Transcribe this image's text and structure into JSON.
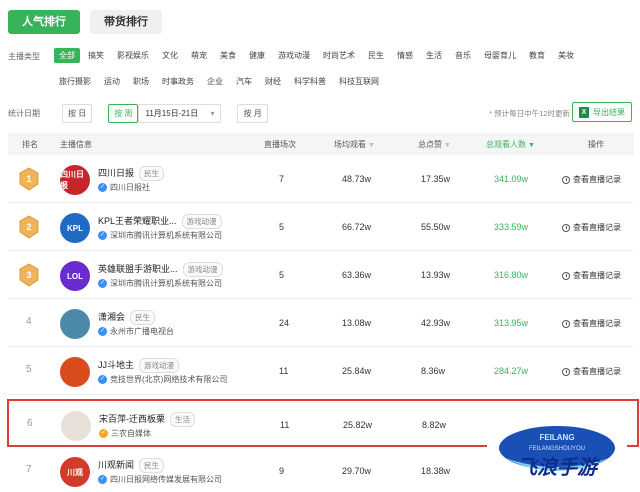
{
  "top_tabs": [
    "人气排行",
    "带货排行"
  ],
  "filter": {
    "label": "主播类型",
    "row1": [
      "全部",
      "搞笑",
      "影视娱乐",
      "文化",
      "萌宠",
      "美食",
      "健康",
      "游戏动漫",
      "时尚艺术",
      "民生",
      "情感",
      "生活",
      "音乐",
      "母婴育儿",
      "教育",
      "美妆"
    ],
    "row2": [
      "旅行摄影",
      "运动",
      "职场",
      "时事政务",
      "企业",
      "汽车",
      "财经",
      "科学科普",
      "科技互联网"
    ]
  },
  "date": {
    "label": "统计日期",
    "day": "按 日",
    "week": "按 周",
    "range": "11月15日-21日",
    "range_icon": "▾",
    "month": "按 月",
    "note": "* 预计每日中午12时更新",
    "export": "导出结果"
  },
  "headers": {
    "rank": "排名",
    "info": "主播信息",
    "sessions": "直播场次",
    "avg_views": "场均观看",
    "likes": "总点赞",
    "viewers": "总观看人数",
    "op": "操作"
  },
  "rows": [
    {
      "rank": "1",
      "name": "四川日报",
      "tag": "民生",
      "org": "四川日报社",
      "sessions": "7",
      "avg": "48.73w",
      "likes": "17.35w",
      "viewers": "341.09w",
      "op": "查看直播记录",
      "avatar_text": "四川日报"
    },
    {
      "rank": "2",
      "name": "KPL王者荣耀职业...",
      "tag": "游戏动漫",
      "org": "深圳市腾讯计算机系统有限公司",
      "sessions": "5",
      "avg": "66.72w",
      "likes": "55.50w",
      "viewers": "333.59w",
      "op": "查看直播记录",
      "avatar_text": "KPL"
    },
    {
      "rank": "3",
      "name": "英雄联盟手游职业...",
      "tag": "游戏动漫",
      "org": "深圳市腾讯计算机系统有限公司",
      "sessions": "5",
      "avg": "63.36w",
      "likes": "13.93w",
      "viewers": "316.80w",
      "op": "查看直播记录",
      "avatar_text": "LOL"
    },
    {
      "rank": "4",
      "name": "潇湘会",
      "tag": "民生",
      "org": "永州市广播电视台",
      "sessions": "24",
      "avg": "13.08w",
      "likes": "42.93w",
      "viewers": "313.95w",
      "op": "查看直播记录",
      "avatar_text": ""
    },
    {
      "rank": "5",
      "name": "JJ斗地主",
      "tag": "游戏动漫",
      "org": "竞技世界(北京)网络技术有限公司",
      "sessions": "11",
      "avg": "25.84w",
      "likes": "8.36w",
      "viewers": "284.27w",
      "op": "查看直播记录",
      "avatar_text": ""
    },
    {
      "rank": "6",
      "name": "宋百萍-迁西板栗",
      "tag": "生活",
      "org": "三农自媒体",
      "sessions": "11",
      "avg": "25.82w",
      "likes": "8.82w",
      "viewers": "",
      "op": "",
      "avatar_text": ""
    },
    {
      "rank": "7",
      "name": "川观新闻",
      "tag": "民生",
      "org": "四川日报网络传媒发展有限公司",
      "sessions": "9",
      "avg": "29.70w",
      "likes": "18.38w",
      "viewers": "",
      "op": "",
      "avatar_text": "川观"
    }
  ],
  "colors": {
    "accent": "#37b45a",
    "highlight": "#e03b3b",
    "verified": "#3a8ef6"
  }
}
